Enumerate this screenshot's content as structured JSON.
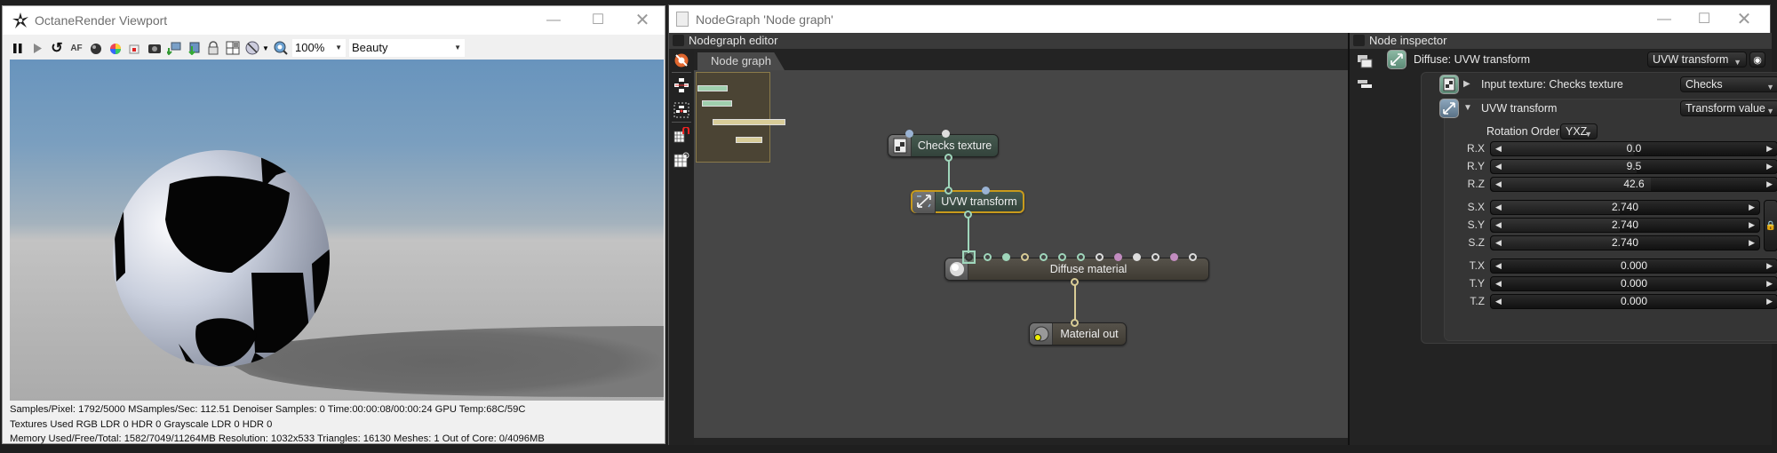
{
  "viewport": {
    "title": "OctaneRender Viewport",
    "toolbar": {
      "icons": [
        "pause-icon",
        "play-icon",
        "reset-icon",
        "autofocus-icon",
        "sphere-pick-icon",
        "color-pick-icon",
        "region-icon",
        "camera-icon",
        "export-icon",
        "import-icon",
        "lock-icon",
        "grid-icon",
        "cursor-pick-icon",
        "zoom-icon"
      ],
      "zoom": "100%",
      "render_pass": "Beauty"
    },
    "status": {
      "line1": "Samples/Pixel: 1792/5000  MSamples/Sec: 112.51  Denoiser Samples: 0  Time:00:00:08/00:00:24  GPU Temp:68C/59C",
      "line2": "Textures Used RGB LDR 0  HDR 0  Grayscale LDR 0  HDR 0",
      "line3": "Memory Used/Free/Total: 1582/7049/11264MB  Resolution: 1032x533  Triangles: 16130  Meshes: 1 Out of Core: 0/4096MB"
    }
  },
  "nodegraph_window": {
    "title": "NodeGraph 'Node graph'"
  },
  "nodegraph_editor": {
    "panel_title": "Nodegraph editor",
    "tab": "Node graph",
    "nodes": [
      {
        "id": "checks",
        "label": "Checks texture"
      },
      {
        "id": "uvw",
        "label": "UVW transform"
      },
      {
        "id": "diffuse",
        "label": "Diffuse material"
      },
      {
        "id": "out",
        "label": "Material out"
      }
    ],
    "pin_colors": {
      "teal": "#9fd6bb",
      "tan": "#d9cc96",
      "white": "#dddddd",
      "pink": "#c28cc0",
      "blue": "#9ab3d4",
      "selection": "#c89a1c"
    }
  },
  "node_inspector": {
    "panel_title": "Node inspector",
    "header": {
      "label": "Diffuse: UVW transform",
      "combo": "UVW transform"
    },
    "input_texture": {
      "label": "Input texture: Checks texture",
      "combo": "Checks"
    },
    "uvw_transform": {
      "label": "UVW transform",
      "combo": "Transform value",
      "rotation_order_label": "Rotation Order",
      "rotation_order": "YXZ",
      "rotation": [
        {
          "label": "R.X",
          "value": "0.0"
        },
        {
          "label": "R.Y",
          "value": "9.5"
        },
        {
          "label": "R.Z",
          "value": "42.6"
        }
      ],
      "scale": [
        {
          "label": "S.X",
          "value": "2.740"
        },
        {
          "label": "S.Y",
          "value": "2.740"
        },
        {
          "label": "S.Z",
          "value": "2.740"
        }
      ],
      "translation": [
        {
          "label": "T.X",
          "value": "0.000"
        },
        {
          "label": "T.Y",
          "value": "0.000"
        },
        {
          "label": "T.Z",
          "value": "0.000"
        }
      ]
    }
  }
}
